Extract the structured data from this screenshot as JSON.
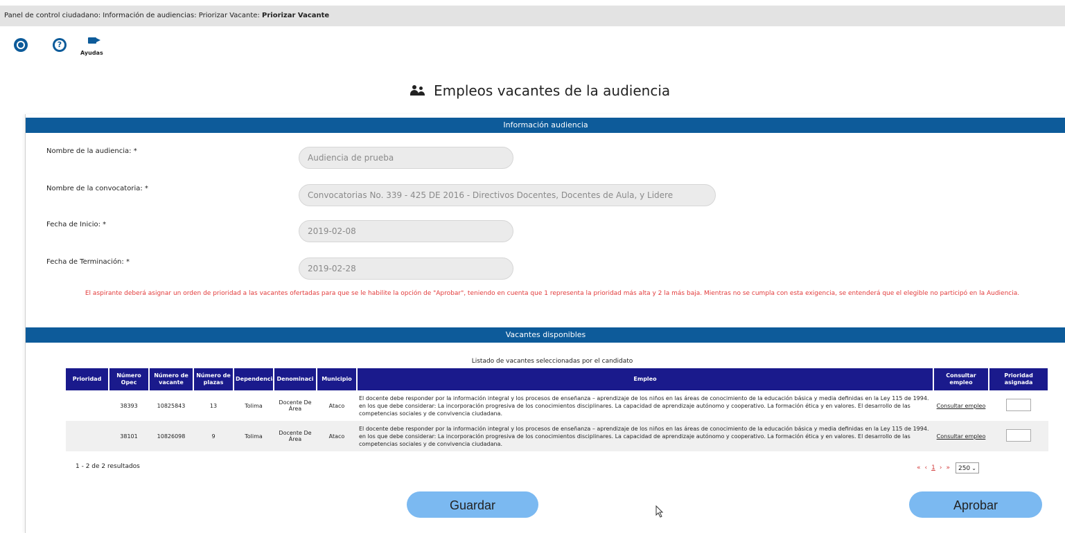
{
  "breadcrumb": {
    "path": "Panel de control ciudadano: Información de audiencias: Priorizar Vacante: ",
    "current": "Priorizar Vacante"
  },
  "toolbar": {
    "icons": [
      "camera-icon",
      "help-icon",
      "video-icon"
    ],
    "video_label": "Ayudas"
  },
  "page": {
    "title": "Empleos vacantes de la audiencia"
  },
  "info_section": {
    "header": "Información audiencia",
    "fields": {
      "audiencia_label": "Nombre de la audiencia: *",
      "audiencia_value": "Audiencia de prueba",
      "convocatoria_label": "Nombre de la convocatoria: *",
      "convocatoria_value": "Convocatorias No. 339 - 425 DE 2016 - Directivos Docentes, Docentes de Aula, y Lidere",
      "inicio_label": "Fecha de Inicio: *",
      "inicio_value": "2019-02-08",
      "fin_label": "Fecha de Terminación: *",
      "fin_value": "2019-02-28"
    },
    "notice": "El aspirante deberá asignar un orden de prioridad a las vacantes ofertadas para que se le habilite la opción de \"Aprobar\", teniendo en cuenta que 1 representa la prioridad más alta y 2 la más baja. Mientras no se cumpla con esta exigencia, se entenderá que el elegible no participó en la Audiencia."
  },
  "vacantes_section": {
    "header": "Vacantes disponibles",
    "caption": "Listado de vacantes seleccionadas por el candidato",
    "columns": [
      "Prioridad",
      "Número Opec",
      "Número de vacante",
      "Número de plazas",
      "Dependencia",
      "Denominaci",
      "Municipio",
      "Empleo",
      "Consultar empleo",
      "Prioridad asignada"
    ],
    "rows": [
      {
        "prioridad": "",
        "opec": "38393",
        "vacante": "10825843",
        "plazas": "13",
        "dependencia": "Tolima",
        "denominacion": "Docente De Área",
        "municipio": "Ataco",
        "empleo": "El docente debe responder por la información integral y los procesos de enseñanza – aprendizaje de los niños en las áreas de conocimiento de la educación básica y media definidas en la Ley 115 de 1994. en los que debe considerar: La incorporación progresiva de los conocimientos disciplinares. La capacidad de aprendizaje autónomo y cooperativo. La formación ética y en valores. El desarrollo de las competencias sociales y de convivencia ciudadana.",
        "consultar": "Consultar empleo",
        "asignada": ""
      },
      {
        "prioridad": "",
        "opec": "38101",
        "vacante": "10826098",
        "plazas": "9",
        "dependencia": "Tolima",
        "denominacion": "Docente De Área",
        "municipio": "Ataco",
        "empleo": "El docente debe responder por la información integral y los procesos de enseñanza – aprendizaje de los niños en las áreas de conocimiento de la educación básica y media definidas en la Ley 115 de 1994. en los que debe considerar: La incorporación progresiva de los conocimientos disciplinares. La capacidad de aprendizaje autónomo y cooperativo. La formación ética y en valores. El desarrollo de las competencias sociales y de convivencia ciudadana.",
        "consultar": "Consultar empleo",
        "asignada": ""
      }
    ],
    "results": "1 - 2 de 2 resultados",
    "pager": {
      "first": "«",
      "prev": "‹",
      "current": "1",
      "next": "›",
      "last": "»",
      "page_size": "250"
    }
  },
  "actions": {
    "guardar": "Guardar",
    "aprobar": "Aprobar"
  }
}
